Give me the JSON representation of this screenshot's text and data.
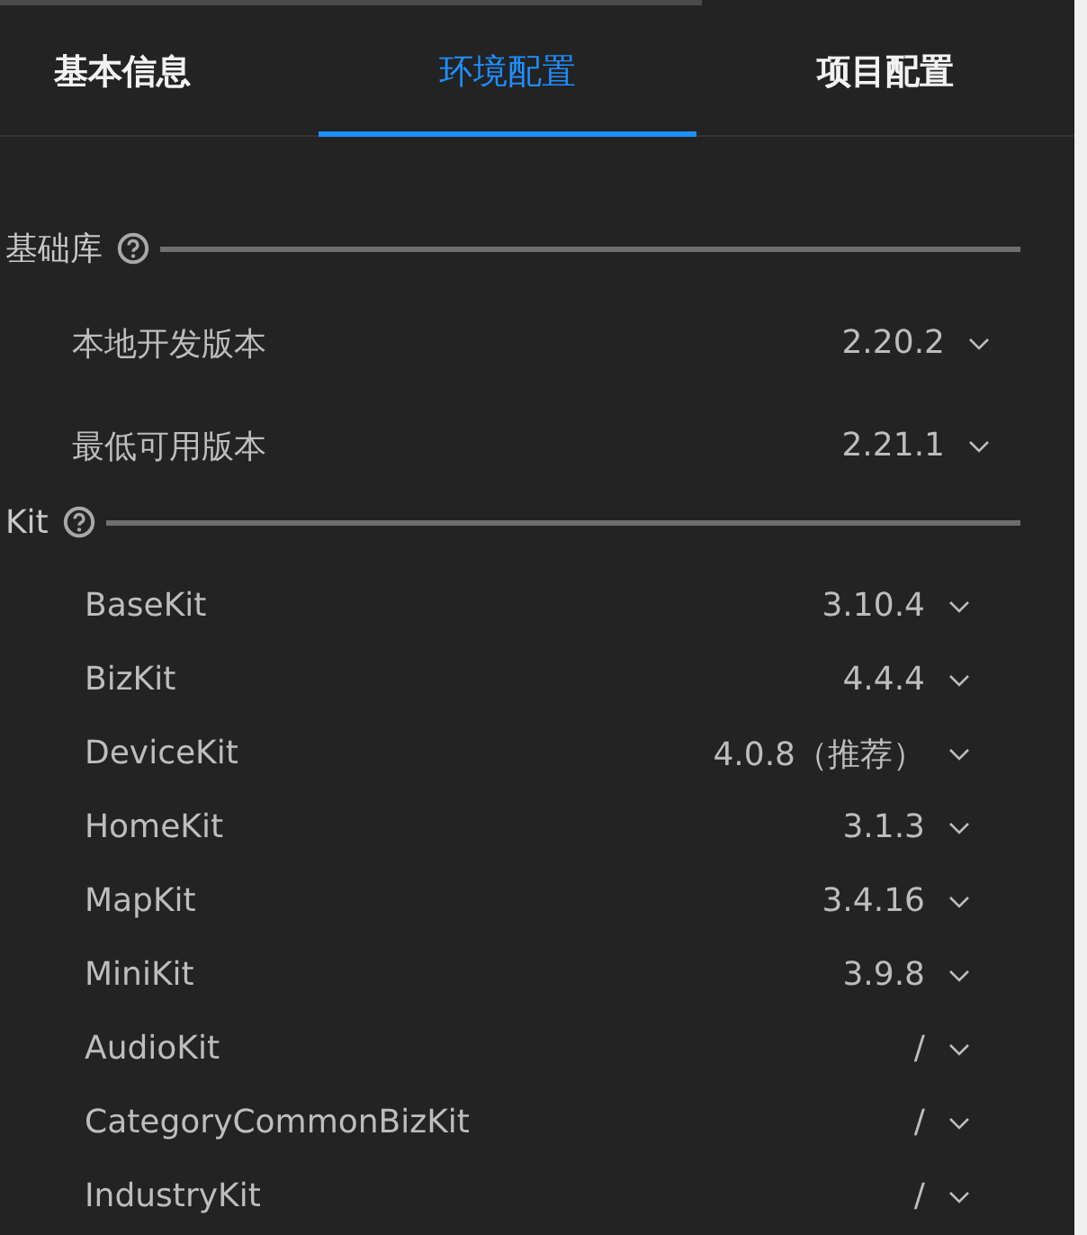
{
  "tabs": [
    {
      "label": "基本信息",
      "selected": false
    },
    {
      "label": "环境配置",
      "selected": true
    },
    {
      "label": "项目配置",
      "selected": false
    }
  ],
  "sections": [
    {
      "title": "基础库",
      "kind": "base",
      "rows": [
        {
          "label": "本地开发版本",
          "value": "2.20.2"
        },
        {
          "label": "最低可用版本",
          "value": "2.21.1"
        }
      ]
    },
    {
      "title": "Kit",
      "kind": "kit",
      "rows": [
        {
          "label": "BaseKit",
          "value": "3.10.4"
        },
        {
          "label": "BizKit",
          "value": "4.4.4"
        },
        {
          "label": "DeviceKit",
          "value": "4.0.8（推荐）"
        },
        {
          "label": "HomeKit",
          "value": "3.1.3"
        },
        {
          "label": "MapKit",
          "value": "3.4.16"
        },
        {
          "label": "MiniKit",
          "value": "3.9.8"
        },
        {
          "label": "AudioKit",
          "value": "/"
        },
        {
          "label": "CategoryCommonBizKit",
          "value": "/"
        },
        {
          "label": "IndustryKit",
          "value": "/"
        }
      ]
    }
  ]
}
